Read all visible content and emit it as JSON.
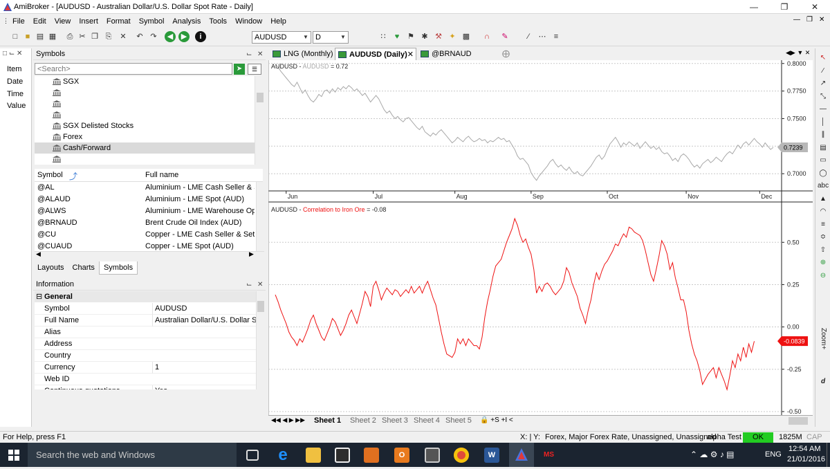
{
  "window": {
    "title": "AmiBroker - [AUDUSD - Australian Dollar/U.S. Dollar Spot Rate - Daily]"
  },
  "menu": [
    "File",
    "Edit",
    "View",
    "Insert",
    "Format",
    "Symbol",
    "Analysis",
    "Tools",
    "Window",
    "Help"
  ],
  "toolbar": {
    "symbol_value": "AUDUSD",
    "interval_value": "D"
  },
  "left_strip": [
    "Item",
    "Date",
    "Time",
    "Value"
  ],
  "symbols_panel": {
    "title": "Symbols",
    "search_placeholder": "<Search>",
    "tree": [
      "SGX",
      "",
      "",
      "",
      "SGX Delisted Stocks",
      "Forex",
      "Cash/Forward",
      ""
    ],
    "selected_tree_index": 6,
    "col_symbol": "Symbol",
    "col_fullname": "Full name",
    "rows": [
      {
        "symbol": "@AL",
        "name": "Aluminium - LME Cash Seller & Se"
      },
      {
        "symbol": "@ALAUD",
        "name": "Aluminium - LME Spot (AUD)"
      },
      {
        "symbol": "@ALWS",
        "name": "Aluminium - LME Warehouse Ope"
      },
      {
        "symbol": "@BRNAUD",
        "name": "Brent Crude Oil Index (AUD)"
      },
      {
        "symbol": "@CU",
        "name": "Copper - LME Cash Seller & Settler"
      },
      {
        "symbol": "@CUAUD",
        "name": "Copper - LME Spot (AUD)"
      }
    ]
  },
  "bottom_tabs": [
    "Layouts",
    "Charts",
    "Symbols"
  ],
  "info_panel": {
    "title": "Information",
    "group": "General",
    "rows": [
      {
        "key": "Symbol",
        "value": "AUDUSD"
      },
      {
        "key": "Full Name",
        "value": "Australian Dollar/U.S. Dollar Spo"
      },
      {
        "key": "Alias",
        "value": ""
      },
      {
        "key": "Address",
        "value": ""
      },
      {
        "key": "Country",
        "value": ""
      },
      {
        "key": "Currency",
        "value": "1"
      },
      {
        "key": "Web ID",
        "value": ""
      },
      {
        "key": "Continuous quotations",
        "value": "Yes"
      }
    ]
  },
  "doc_tabs": [
    {
      "label": "LNG (Monthly)"
    },
    {
      "label": "AUDUSD (Daily)",
      "active": true
    },
    {
      "label": "@BRNAUD (Weekly)"
    }
  ],
  "chart_data": [
    {
      "type": "line",
      "title_symbol": "AUDUSD",
      "title_sep": " - ",
      "title_series": "AUDUSD",
      "title_value": " = 0.72",
      "color": "#a8a8a8",
      "ylim": [
        0.685,
        0.803
      ],
      "y_ticks": [
        "0.8000",
        "0.7750",
        "0.7500",
        "0.7250",
        "0.7000"
      ],
      "y_tick_values": [
        0.8,
        0.775,
        0.75,
        0.725,
        0.7
      ],
      "last_value_label": "0.7239",
      "last_value": 0.7239,
      "x_months": [
        "Jun",
        "Jul",
        "Aug",
        "Sep",
        "Oct",
        "Nov",
        "Dec"
      ],
      "month_start_index": [
        4,
        36,
        66,
        94,
        122,
        151,
        178
      ],
      "values": [
        0.799,
        0.797,
        0.793,
        0.79,
        0.787,
        0.784,
        0.781,
        0.779,
        0.783,
        0.778,
        0.773,
        0.776,
        0.771,
        0.767,
        0.765,
        0.768,
        0.772,
        0.77,
        0.775,
        0.776,
        0.773,
        0.777,
        0.774,
        0.778,
        0.776,
        0.779,
        0.777,
        0.78,
        0.778,
        0.775,
        0.777,
        0.774,
        0.771,
        0.773,
        0.769,
        0.765,
        0.768,
        0.771,
        0.768,
        0.763,
        0.758,
        0.755,
        0.757,
        0.753,
        0.75,
        0.752,
        0.749,
        0.747,
        0.75,
        0.751,
        0.748,
        0.745,
        0.742,
        0.74,
        0.743,
        0.738,
        0.736,
        0.734,
        0.737,
        0.735,
        0.738,
        0.74,
        0.737,
        0.734,
        0.731,
        0.728,
        0.73,
        0.733,
        0.731,
        0.729,
        0.732,
        0.734,
        0.731,
        0.729,
        0.73,
        0.732,
        0.73,
        0.731,
        0.728,
        0.73,
        0.729,
        0.731,
        0.733,
        0.731,
        0.732,
        0.729,
        0.73,
        0.726,
        0.722,
        0.716,
        0.713,
        0.714,
        0.711,
        0.708,
        0.701,
        0.697,
        0.694,
        0.698,
        0.701,
        0.704,
        0.707,
        0.711,
        0.713,
        0.709,
        0.706,
        0.708,
        0.705,
        0.703,
        0.706,
        0.702,
        0.7,
        0.702,
        0.699,
        0.698,
        0.701,
        0.704,
        0.707,
        0.711,
        0.715,
        0.717,
        0.713,
        0.716,
        0.722,
        0.727,
        0.73,
        0.733,
        0.729,
        0.724,
        0.728,
        0.726,
        0.729,
        0.727,
        0.725,
        0.728,
        0.723,
        0.726,
        0.729,
        0.726,
        0.723,
        0.725,
        0.722,
        0.724,
        0.72,
        0.718,
        0.719,
        0.716,
        0.712,
        0.714,
        0.711,
        0.716,
        0.718,
        0.716,
        0.713,
        0.709,
        0.706,
        0.708,
        0.705,
        0.709,
        0.711,
        0.713,
        0.71,
        0.712,
        0.715,
        0.713,
        0.711,
        0.715,
        0.718,
        0.72,
        0.718,
        0.722,
        0.726,
        0.723,
        0.727,
        0.729,
        0.726,
        0.729,
        0.732,
        0.729,
        0.727,
        0.724,
        0.728,
        0.725,
        0.722,
        0.7239
      ]
    },
    {
      "type": "line",
      "title_symbol": "AUDUSD",
      "title_sep": " - ",
      "title_series": "Correlation to Iron Ore",
      "title_value": " = -0.08",
      "color": "#ee1111",
      "ylim": [
        -0.5,
        0.73
      ],
      "y_ticks": [
        "0.50",
        "0.25",
        "0.00",
        "-0.25",
        "-0.50"
      ],
      "y_tick_values": [
        0.5,
        0.25,
        0.0,
        -0.25,
        -0.5
      ],
      "last_value_label": "-0.0839",
      "last_value": -0.0839,
      "values": [
        0.19,
        0.15,
        0.1,
        0.06,
        0.02,
        -0.03,
        -0.06,
        -0.08,
        -0.11,
        -0.07,
        -0.09,
        -0.05,
        -0.01,
        0.04,
        0.07,
        0.02,
        -0.02,
        -0.06,
        -0.08,
        -0.04,
        0.0,
        0.05,
        0.03,
        -0.01,
        -0.05,
        -0.02,
        0.02,
        0.07,
        0.1,
        0.06,
        0.02,
        0.08,
        0.14,
        0.21,
        0.18,
        0.12,
        0.24,
        0.27,
        0.22,
        0.16,
        0.2,
        0.23,
        0.21,
        0.19,
        0.22,
        0.21,
        0.18,
        0.2,
        0.22,
        0.2,
        0.24,
        0.2,
        0.22,
        0.24,
        0.2,
        0.24,
        0.27,
        0.22,
        0.17,
        0.13,
        0.05,
        -0.03,
        -0.1,
        -0.16,
        -0.17,
        -0.18,
        -0.15,
        -0.07,
        -0.1,
        -0.07,
        -0.11,
        -0.07,
        -0.09,
        -0.11,
        -0.11,
        -0.13,
        -0.06,
        0.06,
        0.15,
        0.22,
        0.3,
        0.36,
        0.38,
        0.4,
        0.45,
        0.5,
        0.54,
        0.58,
        0.64,
        0.6,
        0.54,
        0.5,
        0.52,
        0.47,
        0.43,
        0.34,
        0.2,
        0.24,
        0.21,
        0.25,
        0.26,
        0.24,
        0.21,
        0.19,
        0.21,
        0.23,
        0.27,
        0.35,
        0.32,
        0.26,
        0.22,
        0.18,
        0.11,
        0.07,
        0.02,
        0.1,
        0.16,
        0.25,
        0.32,
        0.28,
        0.33,
        0.37,
        0.39,
        0.42,
        0.45,
        0.49,
        0.48,
        0.52,
        0.55,
        0.53,
        0.59,
        0.58,
        0.56,
        0.55,
        0.54,
        0.51,
        0.45,
        0.38,
        0.31,
        0.27,
        0.34,
        0.42,
        0.51,
        0.48,
        0.43,
        0.34,
        0.38,
        0.29,
        0.23,
        0.16,
        0.16,
        0.09,
        -0.02,
        -0.1,
        -0.16,
        -0.2,
        -0.26,
        -0.34,
        -0.31,
        -0.28,
        -0.26,
        -0.24,
        -0.3,
        -0.24,
        -0.28,
        -0.32,
        -0.37,
        -0.29,
        -0.2,
        -0.24,
        -0.16,
        -0.2,
        -0.12,
        -0.18,
        -0.1,
        -0.15,
        -0.0839
      ]
    }
  ],
  "sheets": [
    "Sheet 1",
    "Sheet 2",
    "Sheet 3",
    "Sheet 4",
    "Sheet 5"
  ],
  "status": {
    "help": "For Help, press F1",
    "xy": "X: | Y:",
    "info": "Forex, Major Forex Rate, Unassigned, Unassigned",
    "db": "alpha Test",
    "ok": "OK",
    "mem": "1825M",
    "cap": "CAP"
  },
  "taskbar": {
    "search_placeholder": "Search the web and Windows",
    "lang": "ENG",
    "time": "12:54 AM",
    "date": "21/01/2016",
    "zoom_label": "Zoom+"
  }
}
